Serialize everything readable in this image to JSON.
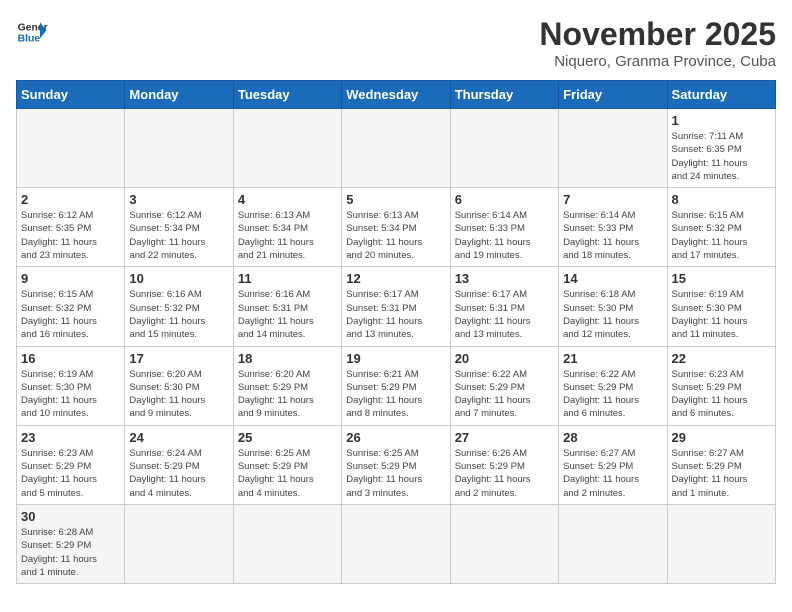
{
  "logo": {
    "line1": "General",
    "line2": "Blue"
  },
  "title": "November 2025",
  "location": "Niquero, Granma Province, Cuba",
  "weekdays": [
    "Sunday",
    "Monday",
    "Tuesday",
    "Wednesday",
    "Thursday",
    "Friday",
    "Saturday"
  ],
  "weeks": [
    [
      {
        "day": "",
        "info": ""
      },
      {
        "day": "",
        "info": ""
      },
      {
        "day": "",
        "info": ""
      },
      {
        "day": "",
        "info": ""
      },
      {
        "day": "",
        "info": ""
      },
      {
        "day": "",
        "info": ""
      },
      {
        "day": "1",
        "info": "Sunrise: 7:11 AM\nSunset: 6:35 PM\nDaylight: 11 hours\nand 24 minutes."
      }
    ],
    [
      {
        "day": "2",
        "info": "Sunrise: 6:12 AM\nSunset: 5:35 PM\nDaylight: 11 hours\nand 23 minutes."
      },
      {
        "day": "3",
        "info": "Sunrise: 6:12 AM\nSunset: 5:34 PM\nDaylight: 11 hours\nand 22 minutes."
      },
      {
        "day": "4",
        "info": "Sunrise: 6:13 AM\nSunset: 5:34 PM\nDaylight: 11 hours\nand 21 minutes."
      },
      {
        "day": "5",
        "info": "Sunrise: 6:13 AM\nSunset: 5:34 PM\nDaylight: 11 hours\nand 20 minutes."
      },
      {
        "day": "6",
        "info": "Sunrise: 6:14 AM\nSunset: 5:33 PM\nDaylight: 11 hours\nand 19 minutes."
      },
      {
        "day": "7",
        "info": "Sunrise: 6:14 AM\nSunset: 5:33 PM\nDaylight: 11 hours\nand 18 minutes."
      },
      {
        "day": "8",
        "info": "Sunrise: 6:15 AM\nSunset: 5:32 PM\nDaylight: 11 hours\nand 17 minutes."
      }
    ],
    [
      {
        "day": "9",
        "info": "Sunrise: 6:15 AM\nSunset: 5:32 PM\nDaylight: 11 hours\nand 16 minutes."
      },
      {
        "day": "10",
        "info": "Sunrise: 6:16 AM\nSunset: 5:32 PM\nDaylight: 11 hours\nand 15 minutes."
      },
      {
        "day": "11",
        "info": "Sunrise: 6:16 AM\nSunset: 5:31 PM\nDaylight: 11 hours\nand 14 minutes."
      },
      {
        "day": "12",
        "info": "Sunrise: 6:17 AM\nSunset: 5:31 PM\nDaylight: 11 hours\nand 13 minutes."
      },
      {
        "day": "13",
        "info": "Sunrise: 6:17 AM\nSunset: 5:31 PM\nDaylight: 11 hours\nand 13 minutes."
      },
      {
        "day": "14",
        "info": "Sunrise: 6:18 AM\nSunset: 5:30 PM\nDaylight: 11 hours\nand 12 minutes."
      },
      {
        "day": "15",
        "info": "Sunrise: 6:19 AM\nSunset: 5:30 PM\nDaylight: 11 hours\nand 11 minutes."
      }
    ],
    [
      {
        "day": "16",
        "info": "Sunrise: 6:19 AM\nSunset: 5:30 PM\nDaylight: 11 hours\nand 10 minutes."
      },
      {
        "day": "17",
        "info": "Sunrise: 6:20 AM\nSunset: 5:30 PM\nDaylight: 11 hours\nand 9 minutes."
      },
      {
        "day": "18",
        "info": "Sunrise: 6:20 AM\nSunset: 5:29 PM\nDaylight: 11 hours\nand 9 minutes."
      },
      {
        "day": "19",
        "info": "Sunrise: 6:21 AM\nSunset: 5:29 PM\nDaylight: 11 hours\nand 8 minutes."
      },
      {
        "day": "20",
        "info": "Sunrise: 6:22 AM\nSunset: 5:29 PM\nDaylight: 11 hours\nand 7 minutes."
      },
      {
        "day": "21",
        "info": "Sunrise: 6:22 AM\nSunset: 5:29 PM\nDaylight: 11 hours\nand 6 minutes."
      },
      {
        "day": "22",
        "info": "Sunrise: 6:23 AM\nSunset: 5:29 PM\nDaylight: 11 hours\nand 6 minutes."
      }
    ],
    [
      {
        "day": "23",
        "info": "Sunrise: 6:23 AM\nSunset: 5:29 PM\nDaylight: 11 hours\nand 5 minutes."
      },
      {
        "day": "24",
        "info": "Sunrise: 6:24 AM\nSunset: 5:29 PM\nDaylight: 11 hours\nand 4 minutes."
      },
      {
        "day": "25",
        "info": "Sunrise: 6:25 AM\nSunset: 5:29 PM\nDaylight: 11 hours\nand 4 minutes."
      },
      {
        "day": "26",
        "info": "Sunrise: 6:25 AM\nSunset: 5:29 PM\nDaylight: 11 hours\nand 3 minutes."
      },
      {
        "day": "27",
        "info": "Sunrise: 6:26 AM\nSunset: 5:29 PM\nDaylight: 11 hours\nand 2 minutes."
      },
      {
        "day": "28",
        "info": "Sunrise: 6:27 AM\nSunset: 5:29 PM\nDaylight: 11 hours\nand 2 minutes."
      },
      {
        "day": "29",
        "info": "Sunrise: 6:27 AM\nSunset: 5:29 PM\nDaylight: 11 hours\nand 1 minute."
      }
    ],
    [
      {
        "day": "30",
        "info": "Sunrise: 6:28 AM\nSunset: 5:29 PM\nDaylight: 11 hours\nand 1 minute.",
        "last": true
      },
      {
        "day": "",
        "info": "",
        "last": true
      },
      {
        "day": "",
        "info": "",
        "last": true
      },
      {
        "day": "",
        "info": "",
        "last": true
      },
      {
        "day": "",
        "info": "",
        "last": true
      },
      {
        "day": "",
        "info": "",
        "last": true
      },
      {
        "day": "",
        "info": "",
        "last": true
      }
    ]
  ]
}
